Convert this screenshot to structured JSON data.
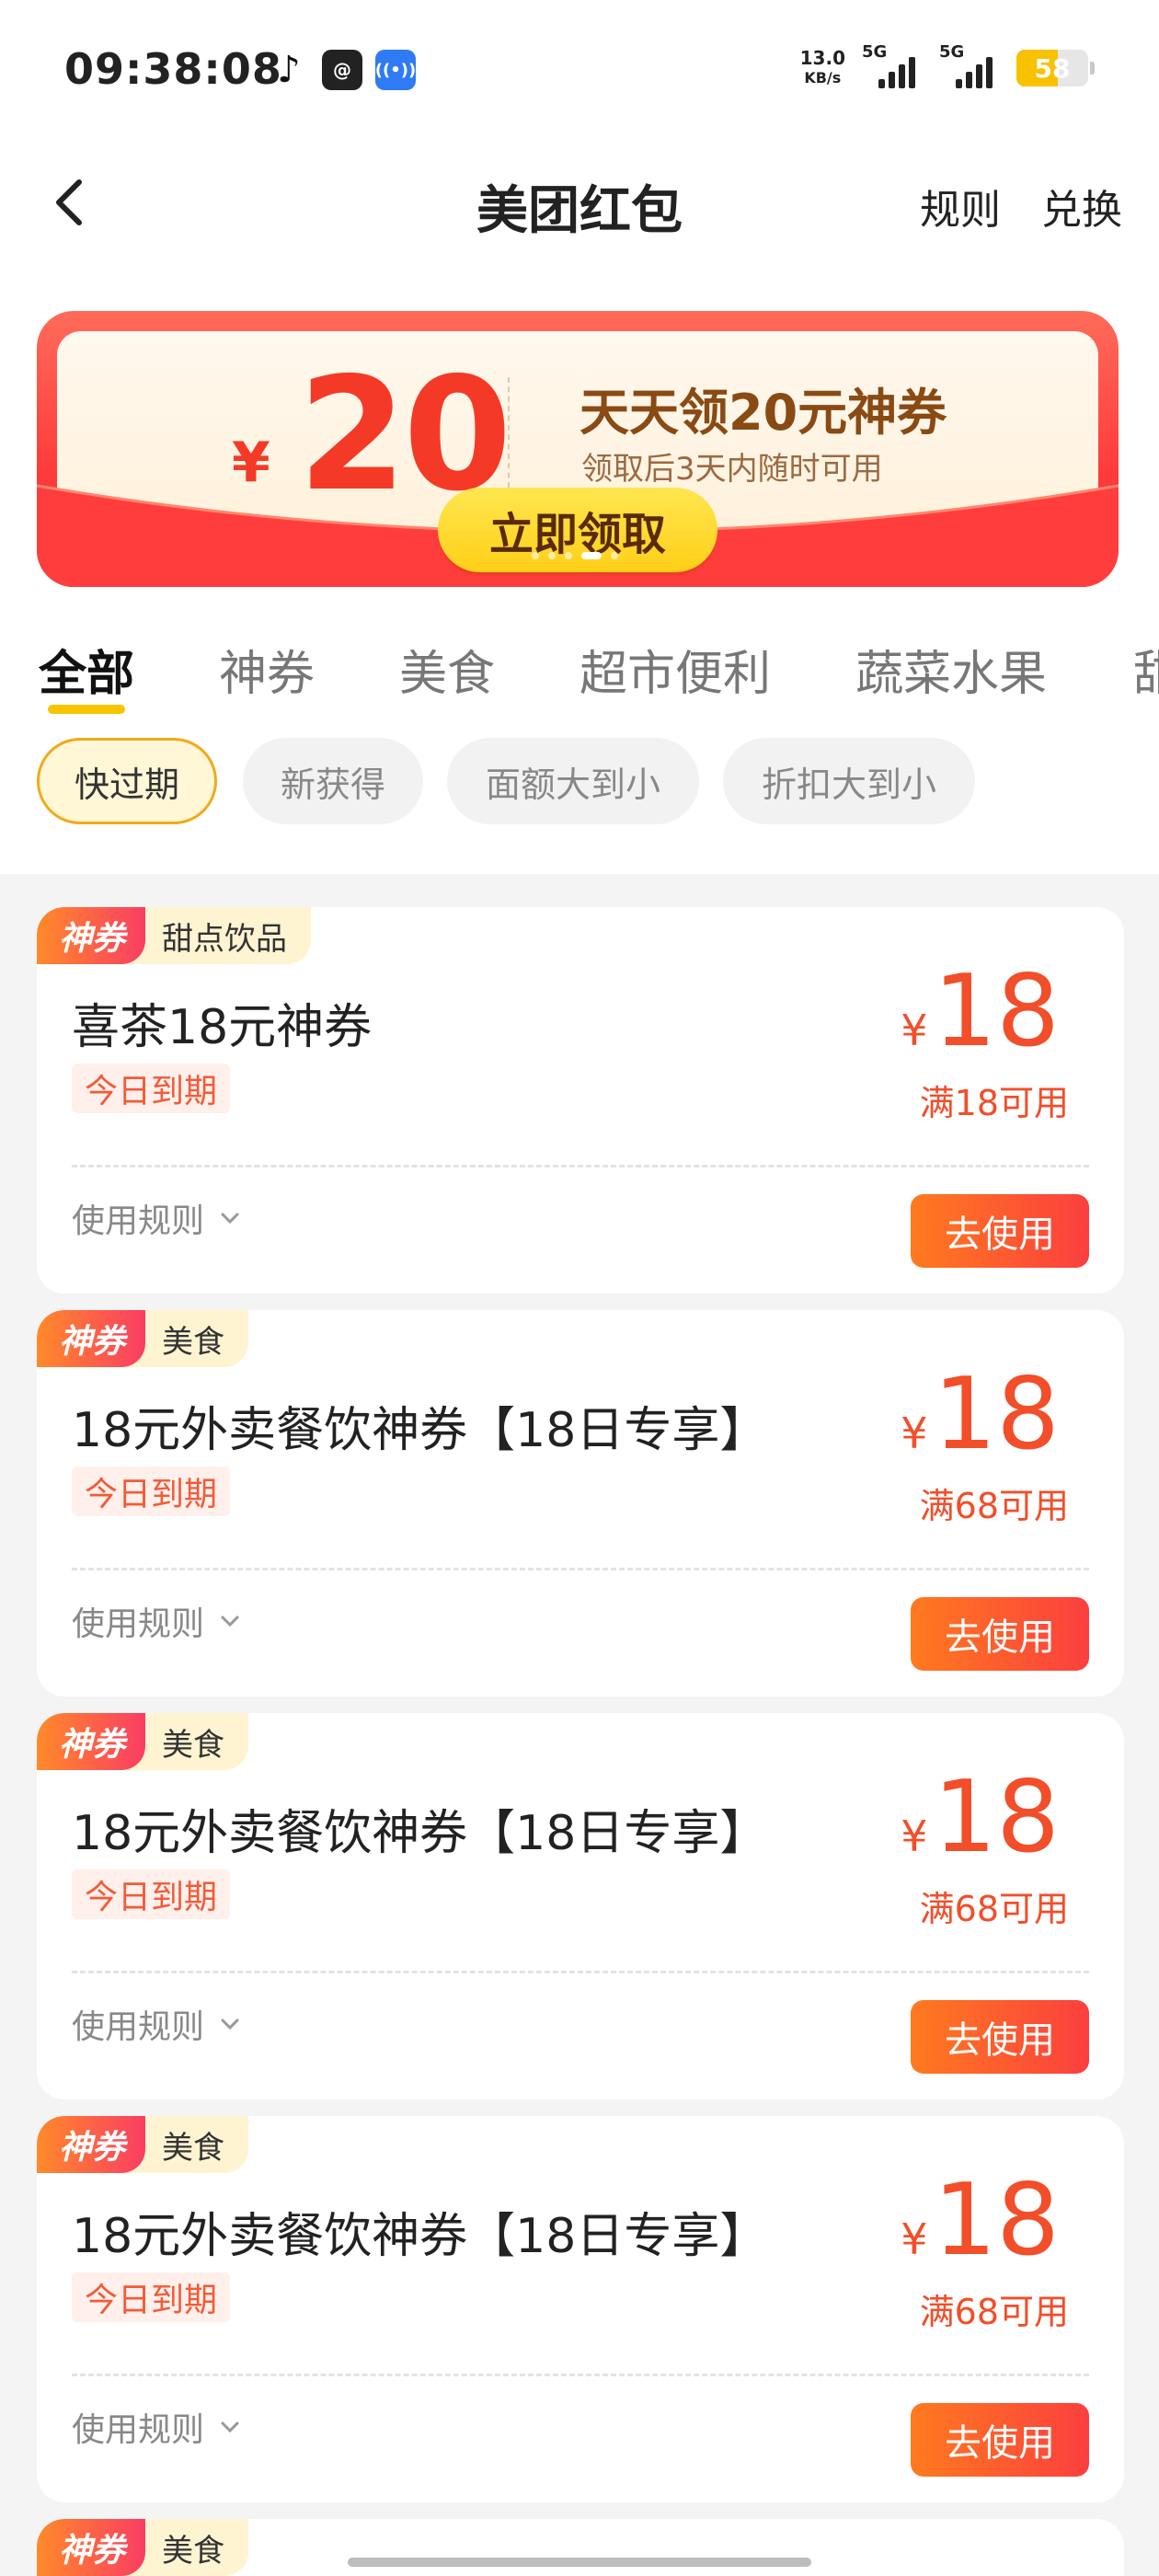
{
  "status_bar": {
    "time": "09:38:08",
    "apps": [
      "tiktok-icon",
      "chat-icon",
      "nfc-icon"
    ],
    "net_speed_value": "13.0",
    "net_speed_unit": "KB/s",
    "signal1_label": "5G",
    "signal2_label": "5G",
    "battery_level": "58",
    "battery_percent": 58
  },
  "header": {
    "title": "美团红包",
    "rules_label": "规则",
    "exchange_label": "兑换"
  },
  "banner": {
    "currency": "¥",
    "amount": "20",
    "title": "天天领20元神券",
    "subtitle": "领取后3天内随时可用",
    "button_label": "立即领取",
    "dots_count": 5,
    "active_dot": 3,
    "colors": {
      "accent": "#f43a27",
      "button": "#ffd21f"
    }
  },
  "tabs": [
    {
      "label": "全部",
      "active": true
    },
    {
      "label": "神券",
      "active": false
    },
    {
      "label": "美食",
      "active": false
    },
    {
      "label": "超市便利",
      "active": false
    },
    {
      "label": "蔬菜水果",
      "active": false
    },
    {
      "label": "甜",
      "active": false
    }
  ],
  "sort_chips": [
    {
      "label": "快过期",
      "active": true
    },
    {
      "label": "新获得",
      "active": false
    },
    {
      "label": "面额大到小",
      "active": false
    },
    {
      "label": "折扣大到小",
      "active": false
    }
  ],
  "coupons": [
    {
      "badge": "神券",
      "category": "甜点饮品",
      "title": "喜茶18元神券",
      "expiry": "今日到期",
      "currency": "¥",
      "amount": "18",
      "condition": "满18可用",
      "rules_label": "使用规则",
      "use_label": "去使用"
    },
    {
      "badge": "神券",
      "category": "美食",
      "title": "18元外卖餐饮神券【18日专享】",
      "expiry": "今日到期",
      "currency": "¥",
      "amount": "18",
      "condition": "满68可用",
      "rules_label": "使用规则",
      "use_label": "去使用"
    },
    {
      "badge": "神券",
      "category": "美食",
      "title": "18元外卖餐饮神券【18日专享】",
      "expiry": "今日到期",
      "currency": "¥",
      "amount": "18",
      "condition": "满68可用",
      "rules_label": "使用规则",
      "use_label": "去使用"
    },
    {
      "badge": "神券",
      "category": "美食",
      "title": "18元外卖餐饮神券【18日专享】",
      "expiry": "今日到期",
      "currency": "¥",
      "amount": "18",
      "condition": "满68可用",
      "rules_label": "使用规则",
      "use_label": "去使用"
    },
    {
      "badge": "神券",
      "category": "美食"
    }
  ],
  "colors": {
    "price": "#f24e2a",
    "use_button_start": "#ff7a1e",
    "use_button_end": "#fb3f3f",
    "active_chip_border": "#f2a91a",
    "tab_underline": "#f7c500"
  }
}
